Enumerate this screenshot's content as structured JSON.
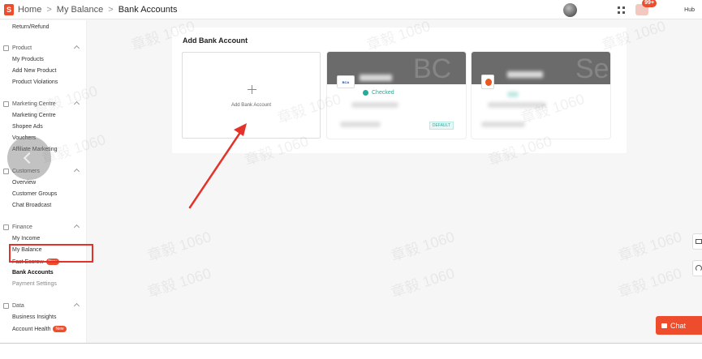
{
  "breadcrumb": {
    "home": "Home",
    "sep": ">",
    "balance": "My Balance",
    "current": "Bank Accounts"
  },
  "header": {
    "logo_letter": "S",
    "notif_count": "99+",
    "shop_label": "Hub"
  },
  "sidebar": {
    "return_refund": "Return/Refund",
    "product": {
      "title": "Product",
      "items": [
        "My Products",
        "Add New Product",
        "Product Violations"
      ]
    },
    "marketing": {
      "title": "Marketing Centre",
      "items": [
        "Marketing Centre",
        "Shopee Ads",
        "Vouchers",
        "Affiliate Marketing"
      ]
    },
    "customers": {
      "title": "Customers",
      "items": [
        "Overview",
        "Customer Groups",
        "Chat Broadcast"
      ]
    },
    "finance": {
      "title": "Finance",
      "items": [
        "My Income",
        "My Balance",
        "Fast Escrow",
        "Bank Accounts",
        "Payment Settings"
      ],
      "new_badge": "New"
    },
    "data": {
      "title": "Data",
      "items": [
        "Business Insights",
        "Account Health"
      ],
      "new_badge": "New"
    }
  },
  "main": {
    "title": "Add Bank Account",
    "add_tile_label": "Add Bank Account",
    "bank_logo_text": "BCA",
    "checked_label": "Checked",
    "default_label": "DEFAULT",
    "bg_letters": [
      "BC",
      "Se"
    ]
  },
  "chat": {
    "label": "Chat"
  },
  "watermark": "章毅 1060",
  "colors": {
    "brand": "#ee4d2d",
    "checked": "#26aa99",
    "annotation": "#e4322b"
  }
}
